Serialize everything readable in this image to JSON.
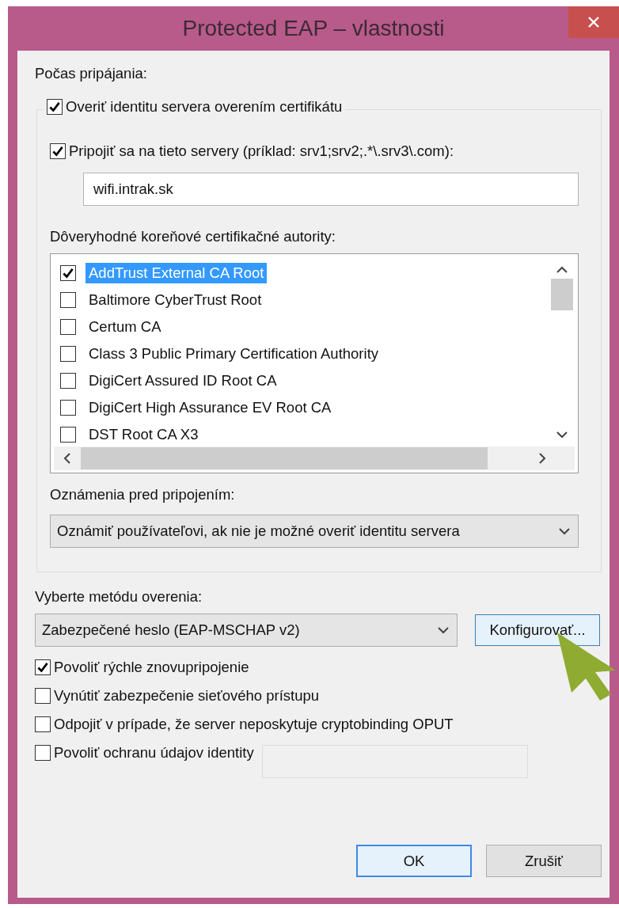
{
  "window": {
    "title": "Protected EAP – vlastnosti"
  },
  "section_label": "Počas pripájania:",
  "verify_server": {
    "label": "Overiť identitu servera overením certifikátu",
    "checked": true
  },
  "connect_servers": {
    "label": "Pripojiť sa na tieto servery (príklad: srv1;srv2;.*\\.srv3\\.com):",
    "checked": true,
    "value": "wifi.intrak.sk"
  },
  "trusted_ca": {
    "label": "Dôveryhodné koreňové certifikačné autority:",
    "items": [
      {
        "label": "AddTrust External CA Root",
        "checked": true,
        "selected": true
      },
      {
        "label": "Baltimore CyberTrust Root",
        "checked": false,
        "selected": false
      },
      {
        "label": "Certum CA",
        "checked": false,
        "selected": false
      },
      {
        "label": "Class 3 Public Primary Certification Authority",
        "checked": false,
        "selected": false
      },
      {
        "label": "DigiCert Assured ID Root CA",
        "checked": false,
        "selected": false
      },
      {
        "label": "DigiCert High Assurance EV Root CA",
        "checked": false,
        "selected": false
      },
      {
        "label": "DST Root CA X3",
        "checked": false,
        "selected": false
      }
    ]
  },
  "notifications": {
    "label": "Oznámenia pred pripojením:",
    "value": "Oznámiť používateľovi, ak nie je možné overiť identitu servera"
  },
  "method": {
    "label": "Vyberte metódu overenia:",
    "value": "Zabezpečené heslo (EAP-MSCHAP v2)"
  },
  "configure_button": {
    "label": "Konfigurovať..."
  },
  "options": [
    {
      "label": "Povoliť rýchle znovupripojenie",
      "checked": true,
      "kind": "plain"
    },
    {
      "label": "Vynútiť zabezpečenie sieťového prístupu",
      "checked": false,
      "kind": "plain"
    },
    {
      "label": "Odpojiť v prípade, že server neposkytuje cryptobinding OPUT",
      "checked": false,
      "kind": "plain"
    },
    {
      "label": "Povoliť ochranu údajov identity",
      "checked": false,
      "kind": "with_field"
    }
  ],
  "buttons": [
    {
      "label": "OK",
      "default": true
    },
    {
      "label": "Zrušiť",
      "default": false
    }
  ]
}
